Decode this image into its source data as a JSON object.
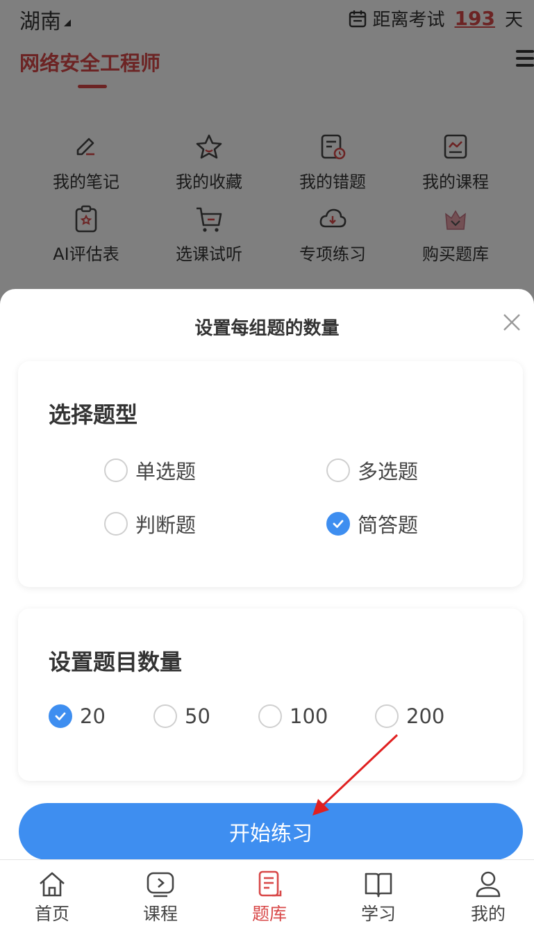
{
  "header": {
    "region": "湖南",
    "countdown_prefix": "距离考试",
    "countdown_days": "193",
    "countdown_suffix": "天"
  },
  "subject_tab": "网络安全工程师",
  "shortcuts": [
    {
      "label": "我的笔记",
      "icon": "pencil-note-icon"
    },
    {
      "label": "我的收藏",
      "icon": "star-icon"
    },
    {
      "label": "我的错题",
      "icon": "wrong-question-doc-icon"
    },
    {
      "label": "我的课程",
      "icon": "chart-course-icon"
    },
    {
      "label": "AI评估表",
      "icon": "clipboard-star-icon"
    },
    {
      "label": "选课试听",
      "icon": "cart-icon"
    },
    {
      "label": "专项练习",
      "icon": "cloud-download-icon"
    },
    {
      "label": "购买题库",
      "icon": "crown-gift-icon"
    }
  ],
  "sheet": {
    "title": "设置每组题的数量",
    "question_type": {
      "heading": "选择题型",
      "options": [
        {
          "label": "单选题",
          "checked": false
        },
        {
          "label": "多选题",
          "checked": false
        },
        {
          "label": "判断题",
          "checked": false
        },
        {
          "label": "简答题",
          "checked": true
        }
      ]
    },
    "question_count": {
      "heading": "设置题目数量",
      "options": [
        {
          "label": "20",
          "checked": true
        },
        {
          "label": "50",
          "checked": false
        },
        {
          "label": "100",
          "checked": false
        },
        {
          "label": "200",
          "checked": false
        }
      ]
    },
    "start_button": "开始练习"
  },
  "bottom_nav": [
    {
      "label": "首页",
      "icon": "home-icon",
      "active": false
    },
    {
      "label": "课程",
      "icon": "play-screen-icon",
      "active": false
    },
    {
      "label": "题库",
      "icon": "question-bank-icon",
      "active": true
    },
    {
      "label": "学习",
      "icon": "open-book-icon",
      "active": false
    },
    {
      "label": "我的",
      "icon": "user-icon",
      "active": false
    }
  ],
  "colors": {
    "accent_red": "#d84848",
    "accent_blue": "#3e8ef0",
    "annotation_arrow": "#e02020"
  }
}
